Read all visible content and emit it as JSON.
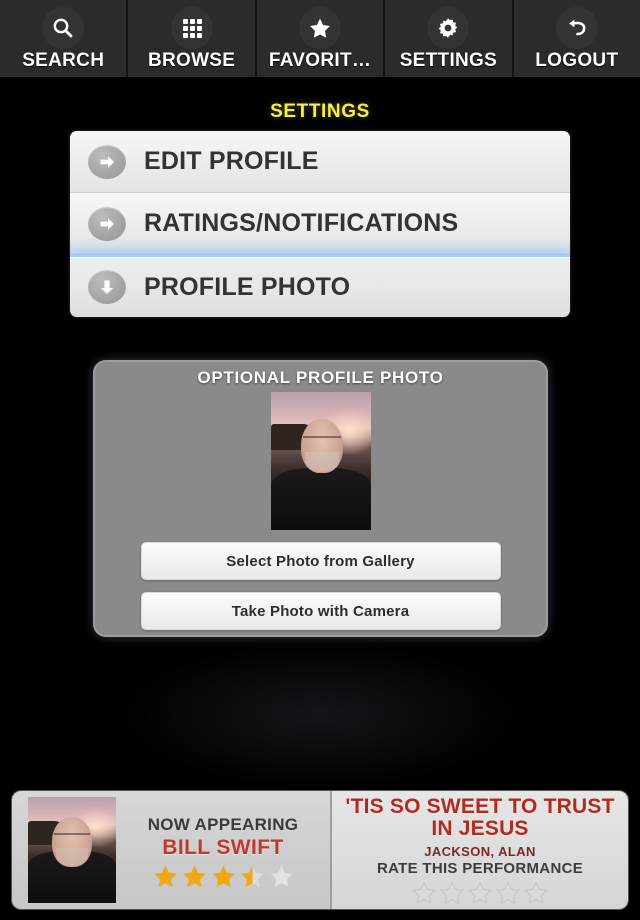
{
  "nav": {
    "items": [
      {
        "label": "SEARCH",
        "icon": "search-icon"
      },
      {
        "label": "BROWSE",
        "icon": "grid-icon"
      },
      {
        "label": "FAVORIT…",
        "icon": "star-icon"
      },
      {
        "label": "SETTINGS",
        "icon": "gear-icon"
      },
      {
        "label": "LOGOUT",
        "icon": "back-arrow-icon"
      }
    ]
  },
  "page": {
    "title": "SETTINGS",
    "title_color": "#f5f13c"
  },
  "menu": {
    "items": [
      {
        "label": "EDIT PROFILE",
        "icon": "arrow-right-icon",
        "active": false
      },
      {
        "label": "RATINGS/NOTIFICATIONS",
        "icon": "arrow-right-icon",
        "active": false
      },
      {
        "label": "PROFILE PHOTO",
        "icon": "arrow-down-icon",
        "active": true
      }
    ],
    "active_glow_color": "#78b9ff"
  },
  "photo_panel": {
    "title": "OPTIONAL PROFILE PHOTO",
    "thumbnail_alt": "profile-photo",
    "buttons": [
      {
        "label": "Select Photo from Gallery"
      },
      {
        "label": "Take Photo with Camera"
      }
    ]
  },
  "banner": {
    "left": {
      "thumbnail_alt": "performer-photo",
      "now_appearing_label": "NOW APPEARING",
      "artist": "BILL SWIFT",
      "artist_color": "#c0392b",
      "rating": 3.5,
      "rating_max": 5,
      "star_filled_color": "#f0a818",
      "star_empty_color": "#e2e2e2"
    },
    "right": {
      "song_title": "'TIS SO SWEET TO TRUST IN JESUS",
      "song_title_color": "#b02b22",
      "song_artist": "JACKSON, ALAN",
      "rate_label": "RATE THIS PERFORMANCE",
      "rate_value": 0,
      "rate_max": 5,
      "rate_star_color": "#d9d9d9"
    }
  }
}
